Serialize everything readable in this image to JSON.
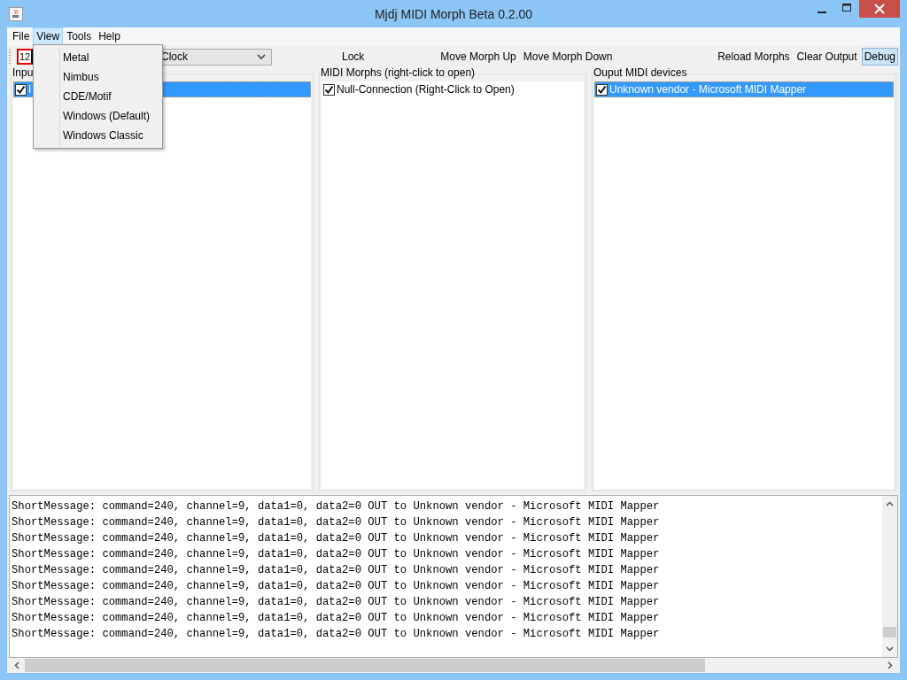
{
  "window": {
    "title": "Mjdj MIDI Morph Beta 0.2.00"
  },
  "menus": [
    {
      "label": "File",
      "selected": false
    },
    {
      "label": "View",
      "selected": true
    },
    {
      "label": "Tools",
      "selected": false
    },
    {
      "label": "Help",
      "selected": false
    }
  ],
  "open_menu": {
    "items": [
      "Metal",
      "Nimbus",
      "CDE/Motif",
      "Windows (Default)",
      "Windows Classic"
    ]
  },
  "toolbar": {
    "tempo_field": {
      "value": "12"
    },
    "combo": {
      "value": "Clock"
    },
    "left_buttons": [
      {
        "label": "Lock",
        "selected": false
      }
    ],
    "mid_buttons": [
      {
        "label": "Move Morph Up",
        "selected": false
      },
      {
        "label": "Move Morph Down",
        "selected": false
      }
    ],
    "right_buttons": [
      {
        "label": "Reload Morphs",
        "selected": false
      },
      {
        "label": "Clear Output",
        "selected": false
      },
      {
        "label": "Debug",
        "selected": true
      }
    ]
  },
  "panels": [
    {
      "title": "Inpu",
      "items": [
        {
          "label": "I",
          "checked": true,
          "selected": true
        }
      ]
    },
    {
      "title": "MIDI Morphs (right-click to open)",
      "items": [
        {
          "label": "Null-Connection (Right-Click to Open)",
          "checked": true,
          "selected": false
        }
      ]
    },
    {
      "title": "Ouput MIDI devices",
      "items": [
        {
          "label": "Unknown vendor - Microsoft MIDI Mapper",
          "checked": true,
          "selected": true
        }
      ]
    }
  ],
  "output": {
    "lines": [
      "ShortMessage: command=240, channel=9, data1=0, data2=0 OUT to Unknown vendor - Microsoft MIDI Mapper",
      "ShortMessage: command=240, channel=9, data1=0, data2=0 OUT to Unknown vendor - Microsoft MIDI Mapper",
      "ShortMessage: command=240, channel=9, data1=0, data2=0 OUT to Unknown vendor - Microsoft MIDI Mapper",
      "ShortMessage: command=240, channel=9, data1=0, data2=0 OUT to Unknown vendor - Microsoft MIDI Mapper",
      "ShortMessage: command=240, channel=9, data1=0, data2=0 OUT to Unknown vendor - Microsoft MIDI Mapper",
      "ShortMessage: command=240, channel=9, data1=0, data2=0 OUT to Unknown vendor - Microsoft MIDI Mapper",
      "ShortMessage: command=240, channel=9, data1=0, data2=0 OUT to Unknown vendor - Microsoft MIDI Mapper",
      "ShortMessage: command=240, channel=9, data1=0, data2=0 OUT to Unknown vendor - Microsoft MIDI Mapper",
      "ShortMessage: command=240, channel=9, data1=0, data2=0 OUT to Unknown vendor - Microsoft MIDI Mapper"
    ]
  }
}
